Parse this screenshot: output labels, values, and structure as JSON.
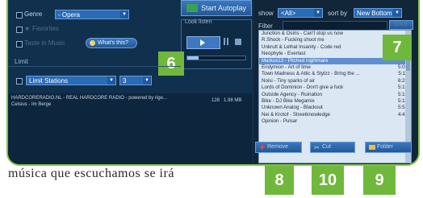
{
  "left_panel": {
    "genre_label": "Genre",
    "genre_value": "- Opera",
    "favorites_label": "Favorites",
    "taste_label": "Taste in Music",
    "whats_this": "What's this?",
    "start_autoplay": "Start Autoplay",
    "look_listen": "Look listen",
    "limit_header": "Limit",
    "limit_stations_label": "Limit Stations",
    "limit_value": "3",
    "station_text": "HARDCORERADIO.NL - REAL HARDCORE RADIO - powered by rige...",
    "station_sub": "Celsius - Im Berge",
    "station_bitrate": "128",
    "station_size": "1.98 MB"
  },
  "right_panel": {
    "show_label": "show",
    "show_value": "<All>",
    "sort_label": "sort by",
    "sort_value": "New Bottom",
    "filter_label": "Filter",
    "clear_label": "Clear",
    "remove_label": "Remove",
    "cut_label": "Cut",
    "folder_label": "Folder"
  },
  "playlist": [
    {
      "title": "Junction & Osiris - Can't stop us now",
      "dur": ""
    },
    {
      "title": "R.Shock - Fucking shoot me",
      "dur": ""
    },
    {
      "title": "Unkrutt & Lethal Insanity - Code red",
      "dur": ""
    },
    {
      "title": "Neophyte - Everlast",
      "dur": ""
    },
    {
      "title": "Markus13 - Pitched nightmare",
      "dur": ""
    },
    {
      "title": "Endymion - Art of time",
      "dur": "5:08"
    },
    {
      "title": "Town Madness & Attic & Stylzz - Bring the ...",
      "dur": "5:11"
    },
    {
      "title": "Noisi - Tiny sparks of air",
      "dur": "6:25"
    },
    {
      "title": "Lords of Dominion - Don't give a fuck",
      "dur": "5:12"
    },
    {
      "title": "Outside Agency - Ruination",
      "dur": "5:15"
    },
    {
      "title": "Bike - DJ Bike Megamix",
      "dur": "5:18"
    },
    {
      "title": "Unknown Analog - Blackout",
      "dur": "5:51"
    },
    {
      "title": "Nei & Krotof - Streetknowledge",
      "dur": "4:42"
    },
    {
      "title": "Opinion - Pulsar",
      "dur": ""
    }
  ],
  "callouts": {
    "c6": "6",
    "c7": "7",
    "c8": "8",
    "c10": "10",
    "c9": "9"
  },
  "bottom_text": "música que escuchamos se irá",
  "colors": {
    "accent_green": "#6fb83c",
    "panel_blue": "#10304d",
    "selection": "#5f8fcf"
  }
}
